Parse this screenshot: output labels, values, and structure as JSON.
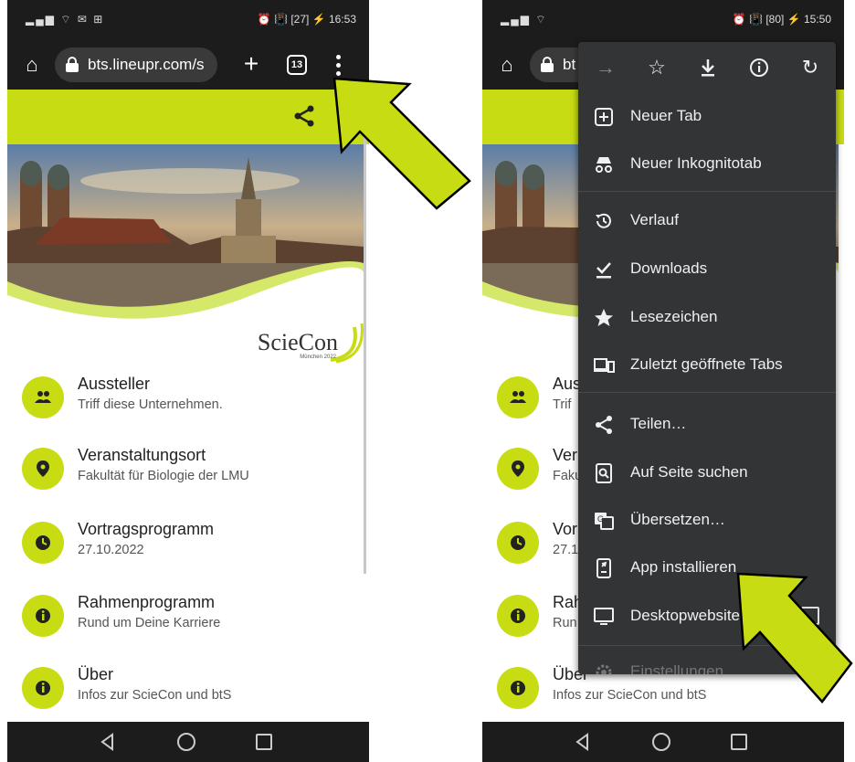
{
  "left": {
    "status": {
      "left_icons": "▂▄▆ ⌔ ✉ ⊞",
      "right_text": "⏰ 📳 [27] ⚡ 16:53"
    },
    "browser": {
      "url": "bts.lineupr.com/s",
      "tab_count": "13"
    },
    "logo": {
      "name": "ScieCon",
      "sub": "München 2022"
    },
    "items": [
      {
        "title": "Aussteller",
        "subtitle": "Triff diese Unternehmen.",
        "icon": "people-icon"
      },
      {
        "title": "Veranstaltungsort",
        "subtitle": "Fakultät für Biologie der LMU",
        "icon": "location-pin-icon"
      },
      {
        "title": "Vortragsprogramm",
        "subtitle": "27.10.2022",
        "icon": "clock-icon"
      },
      {
        "title": "Rahmenprogramm",
        "subtitle": "Rund um Deine Karriere",
        "icon": "info-icon"
      },
      {
        "title": "Über",
        "subtitle": "Infos zur ScieCon und btS",
        "icon": "info-icon"
      }
    ]
  },
  "right": {
    "status": {
      "left_icons": "▂▄▆ ⌔",
      "right_text": "⏰ 📳 [80] ⚡ 15:50"
    },
    "browser": {
      "url_fragment": "bt"
    },
    "items": [
      {
        "title": "Auss",
        "subtitle": "Trif"
      },
      {
        "title": "Ver",
        "subtitle": "Faku"
      },
      {
        "title": "Vor",
        "subtitle": "27.1"
      },
      {
        "title": "Rah",
        "subtitle": "Run"
      },
      {
        "title": "Über",
        "subtitle": "Infos zur ScieCon und btS"
      }
    ],
    "menu": {
      "toolbar_icons": [
        "forward-icon",
        "star-icon",
        "download-icon",
        "info-icon",
        "reload-icon"
      ],
      "entries": [
        {
          "label": "Neuer Tab",
          "icon": "new-tab-icon"
        },
        {
          "label": "Neuer Inkognitotab",
          "icon": "incognito-icon"
        },
        {
          "label": "Verlauf",
          "icon": "history-icon"
        },
        {
          "label": "Downloads",
          "icon": "downloads-icon"
        },
        {
          "label": "Lesezeichen",
          "icon": "bookmark-star-icon"
        },
        {
          "label": "Zuletzt geöffnete Tabs",
          "icon": "recent-tabs-icon"
        },
        {
          "label": "Teilen…",
          "icon": "share-icon"
        },
        {
          "label": "Auf Seite suchen",
          "icon": "find-in-page-icon"
        },
        {
          "label": "Übersetzen…",
          "icon": "translate-icon"
        },
        {
          "label": "App installieren",
          "icon": "install-app-icon"
        },
        {
          "label": "Desktopwebsite",
          "icon": "desktop-icon"
        },
        {
          "label": "Einstellungen",
          "icon": "settings-icon"
        }
      ]
    }
  },
  "colors": {
    "accent": "#c8dc14",
    "dark_bar": "#1c1c1c",
    "menu_bg": "#333436"
  }
}
